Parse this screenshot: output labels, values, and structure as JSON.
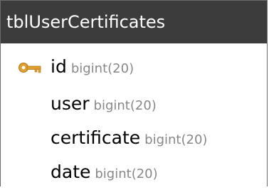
{
  "table": {
    "name": "tblUserCertificates",
    "fields": [
      {
        "name": "id",
        "type": "bigint(20)",
        "primary_key": true,
        "icon": "key-icon"
      },
      {
        "name": "user",
        "type": "bigint(20)",
        "primary_key": false
      },
      {
        "name": "certificate",
        "type": "bigint(20)",
        "primary_key": false
      },
      {
        "name": "date",
        "type": "bigint(20)",
        "primary_key": false
      }
    ]
  },
  "colors": {
    "header_background": "#3c3c3c",
    "header_text": "#ffffff",
    "field_name": "#000000",
    "field_type": "#888888",
    "key_icon": "#e0a030"
  }
}
